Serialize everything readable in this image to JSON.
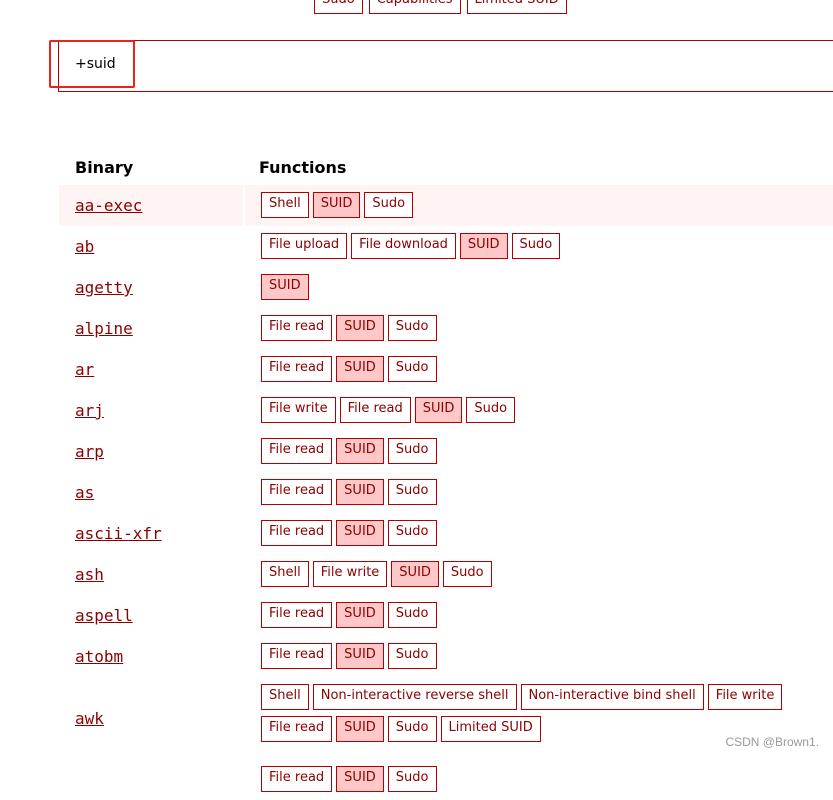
{
  "filters": [
    "Sudo",
    "Capabilities",
    "Limited SUID"
  ],
  "search": {
    "value": "+suid"
  },
  "table": {
    "header_binary": "Binary",
    "header_functions": "Functions",
    "rows": [
      {
        "name": "aa-exec",
        "functions": [
          "Shell",
          "SUID",
          "Sudo"
        ]
      },
      {
        "name": "ab",
        "functions": [
          "File upload",
          "File download",
          "SUID",
          "Sudo"
        ]
      },
      {
        "name": "agetty",
        "functions": [
          "SUID"
        ]
      },
      {
        "name": "alpine",
        "functions": [
          "File read",
          "SUID",
          "Sudo"
        ]
      },
      {
        "name": "ar",
        "functions": [
          "File read",
          "SUID",
          "Sudo"
        ]
      },
      {
        "name": "arj",
        "functions": [
          "File write",
          "File read",
          "SUID",
          "Sudo"
        ]
      },
      {
        "name": "arp",
        "functions": [
          "File read",
          "SUID",
          "Sudo"
        ]
      },
      {
        "name": "as",
        "functions": [
          "File read",
          "SUID",
          "Sudo"
        ]
      },
      {
        "name": "ascii-xfr",
        "functions": [
          "File read",
          "SUID",
          "Sudo"
        ]
      },
      {
        "name": "ash",
        "functions": [
          "Shell",
          "File write",
          "SUID",
          "Sudo"
        ]
      },
      {
        "name": "aspell",
        "functions": [
          "File read",
          "SUID",
          "Sudo"
        ]
      },
      {
        "name": "atobm",
        "functions": [
          "File read",
          "SUID",
          "Sudo"
        ]
      },
      {
        "name": "awk",
        "functions": [
          "Shell",
          "Non-interactive reverse shell",
          "Non-interactive bind shell",
          "File write",
          "File read",
          "SUID",
          "Sudo",
          "Limited SUID"
        ]
      },
      {
        "name": "",
        "functions": [
          "File read",
          "SUID",
          "Sudo"
        ]
      }
    ]
  },
  "highlight_chip": "SUID",
  "watermark": "CSDN @Brown1."
}
